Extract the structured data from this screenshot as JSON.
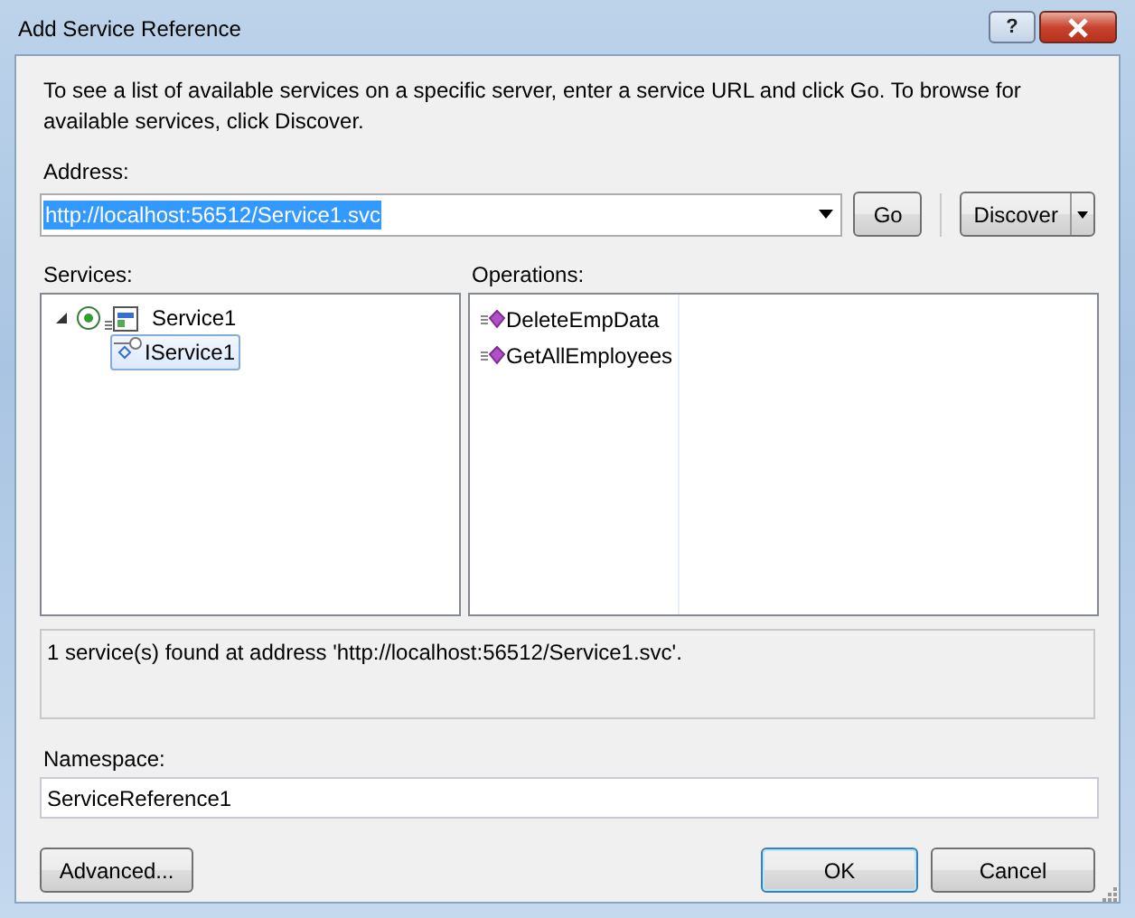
{
  "window": {
    "title": "Add Service Reference",
    "help_button": "?"
  },
  "description": "To see a list of available services on a specific server, enter a service URL and click Go. To browse for available services, click Discover.",
  "address": {
    "label": "Address:",
    "value": "http://localhost:56512/Service1.svc",
    "text_selected": true
  },
  "go_button": "Go",
  "discover_button": "Discover",
  "services": {
    "label": "Services:",
    "tree": [
      {
        "label": "Service1",
        "expanded": true,
        "selected": false,
        "children": [
          {
            "label": "IService1",
            "selected": true
          }
        ]
      }
    ]
  },
  "operations": {
    "label": "Operations:",
    "items": [
      "DeleteEmpData",
      "GetAllEmployees"
    ]
  },
  "status": "1 service(s) found at address 'http://localhost:56512/Service1.svc'.",
  "namespace": {
    "label": "Namespace:",
    "value": "ServiceReference1"
  },
  "buttons": [
    {
      "label": "Advanced...",
      "default": false
    },
    {
      "label": "OK",
      "default": true
    },
    {
      "label": "Cancel",
      "default": false
    }
  ]
}
